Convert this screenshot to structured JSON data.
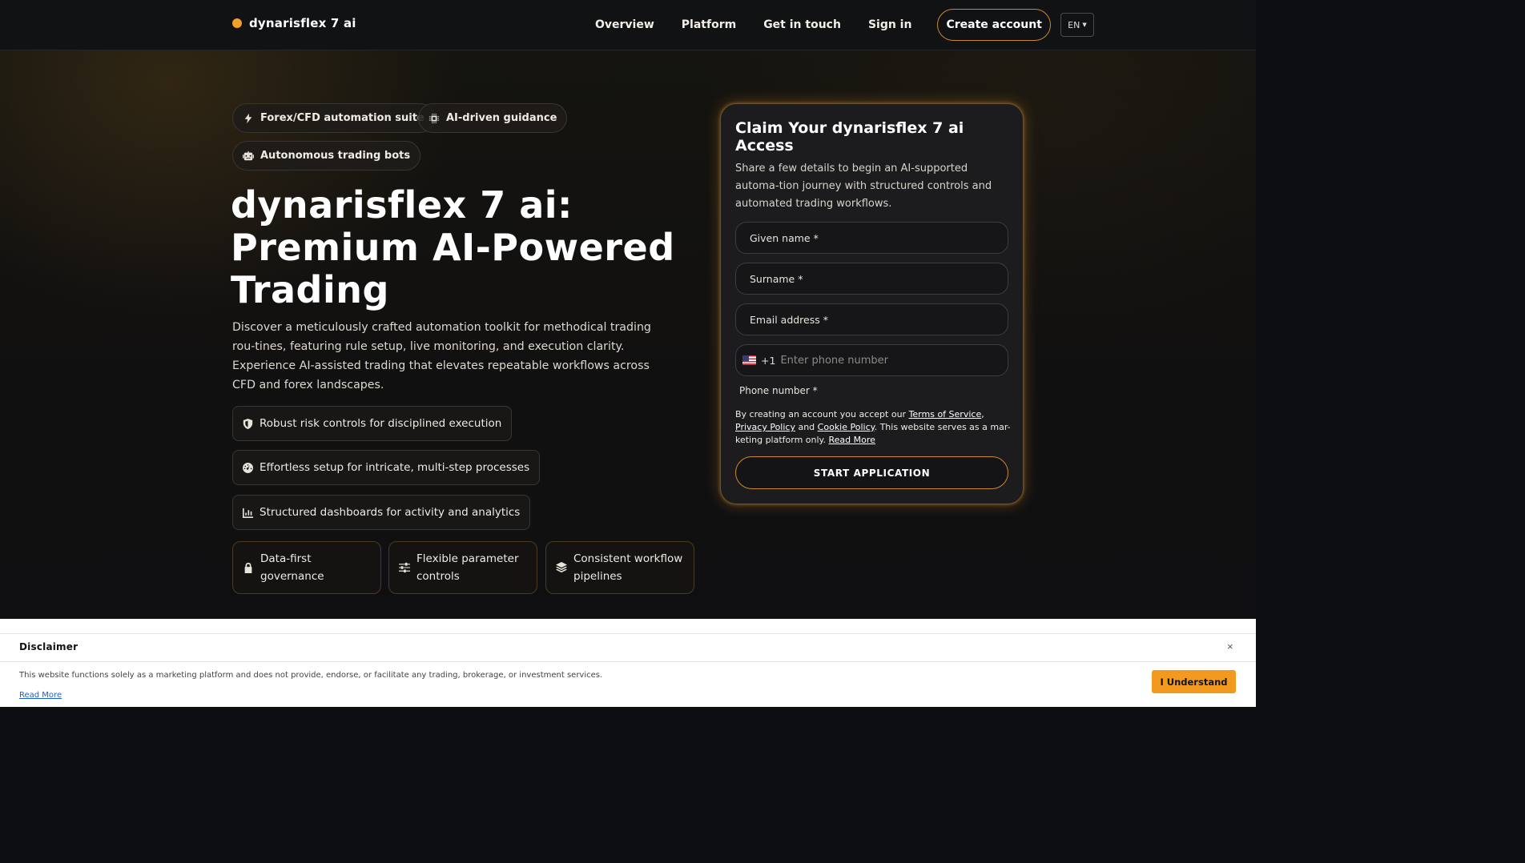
{
  "brand": {
    "name": "dynarisflex 7 ai",
    "accent": "#f1a02a"
  },
  "nav": {
    "links": [
      "Overview",
      "Platform",
      "Get in touch",
      "Sign in"
    ],
    "create_account": "Create account",
    "language": "EN"
  },
  "chips": [
    {
      "label": "Forex/CFD automation suite",
      "icon": "lightning-icon"
    },
    {
      "label": "AI-driven guidance",
      "icon": "chip-icon"
    },
    {
      "label": "Autonomous trading bots",
      "icon": "robot-icon"
    }
  ],
  "hero": {
    "title_line1": "dynarisflex 7 ai:",
    "title_line2": "Premium AI-Powered",
    "title_line3": "Trading",
    "description": "Discover a meticulously crafted automation toolkit for methodical trading rou-tines, featuring rule setup, live monitoring, and execution clarity. Experience AI-assisted trading that elevates repeatable workflows across CFD and forex landscapes."
  },
  "features": [
    {
      "label": "Robust risk controls for disciplined execution",
      "icon": "shield-icon"
    },
    {
      "label": "Effortless setup for intricate, multi-step processes",
      "icon": "gauge-icon"
    },
    {
      "label": "Structured dashboards for activity and analytics",
      "icon": "bar-chart-icon"
    }
  ],
  "cards": [
    {
      "label": "Data-first governance",
      "icon": "lock-icon"
    },
    {
      "label": "Flexible parameter controls",
      "icon": "sliders-icon"
    },
    {
      "label": "Consistent workflow pipelines",
      "icon": "layers-icon"
    }
  ],
  "form": {
    "title": "Claim Your dynarisflex 7 ai Access",
    "subtitle": "Share a few details to begin an AI-supported automa-tion journey with structured controls and automated trading workflows.",
    "given_name": "Given name *",
    "surname": "Surname *",
    "email": "Email address *",
    "dial_code": "+1",
    "phone_placeholder": "Enter phone number",
    "phone_label": "Phone number *",
    "terms_prefix": "By creating an account you accept our ",
    "terms_of_service": "Terms of Service",
    "terms_comma": ",",
    "privacy_policy": "Privacy Policy",
    "terms_and": " and ",
    "cookie_policy": "Cookie Policy",
    "terms_suffix": ". This website serves as a mar-keting platform only. ",
    "read_more": "Read More",
    "submit": "START APPLICATION"
  },
  "disclaimer": {
    "title": "Disclaimer",
    "close": "×",
    "text": "This website functions solely as a marketing platform and does not provide, endorse, or facilitate any trading, brokerage, or investment services.",
    "read_more": "Read More",
    "accept": "I Understand"
  }
}
